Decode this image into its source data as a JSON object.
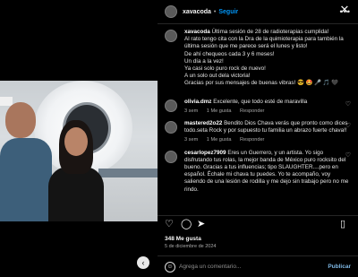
{
  "post": {
    "username": "xavacoda",
    "follow_label": "Seguir",
    "caption_user": "xavacoda",
    "caption_lines": [
      "Última sesión de 28 de radioterapias cumplida!",
      "Al rato tengo cita con la Dra de la quimioterapia para también la última sesión que me parece será el lunes y listo!",
      "De ahí chequeos cada 3 y 6 meses!",
      "Un día a la vez!",
      "Ya casi solo puro rock de nuevo!",
      "A un solo out dela victoria!",
      "Gracias por sus mensajes de buenas vibras! 😎 🤩 🎤 🎵 🖤"
    ]
  },
  "comments": [
    {
      "user": "olivia.dmz",
      "text": "Excelente, que todo esté de maravilla",
      "time": "3 sem",
      "likes": "1 Me gusta",
      "reply": "Responder"
    },
    {
      "user": "mastered2o22",
      "text": "Bendito Dios Chava verás que pronto como dices todo.seta Rock y por supuesto tu familia un abrazo fuerte chava!!",
      "time": "3 sem",
      "likes": "1 Me gusta",
      "reply": "Responder"
    },
    {
      "user": "cesarlopez7909",
      "text": "Eres un Guerrero, y un artista. Yo sigo disfrutando tus rolas, la mejor banda de México puro rocksito del bueno. Gracias a tus influencias; tipo SLAUGHTER....pero en español. Échale mi chava tu puedes. Yo te acompaño, voy saliendo de una lesión de rodilla y me dejo sin trabajo pero no me rindo.",
      "time": "",
      "likes": "",
      "reply": ""
    }
  ],
  "footer": {
    "likes": "348 Me gusta",
    "date": "5 de diciembre de 2024",
    "comment_placeholder": "Agrega un comentario...",
    "post_label": "Publicar"
  },
  "icons": {
    "close": "close-icon",
    "more": "more-options-icon",
    "like": "heart-icon",
    "comment": "comment-icon",
    "share": "share-icon",
    "save": "bookmark-icon",
    "emoji": "emoji-icon",
    "back": "back-arrow-icon"
  }
}
